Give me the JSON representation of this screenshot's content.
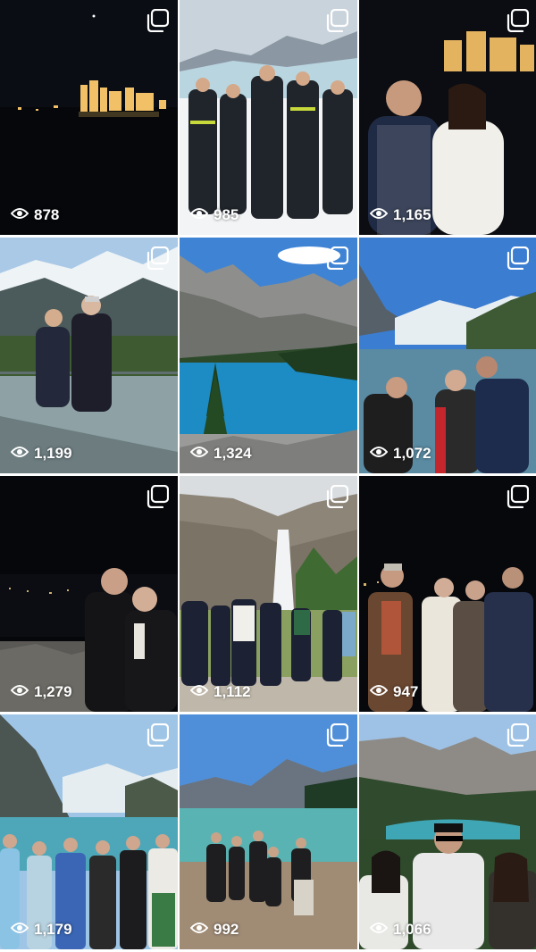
{
  "grid": {
    "posts": [
      {
        "views": "878",
        "scene": "night-castle-lights",
        "icon": "multi-photo-icon"
      },
      {
        "views": "985",
        "scene": "glacier-group-photo",
        "icon": "multi-photo-icon"
      },
      {
        "views": "1,165",
        "scene": "night-couple-castle",
        "icon": "multi-photo-icon"
      },
      {
        "views": "1,199",
        "scene": "glass-skywalk-mountains",
        "icon": "multi-photo-icon"
      },
      {
        "views": "1,324",
        "scene": "moraine-lake",
        "icon": "multi-photo-icon"
      },
      {
        "views": "1,072",
        "scene": "lake-group-selfie",
        "icon": "multi-photo-icon"
      },
      {
        "views": "1,279",
        "scene": "night-couple-overlook",
        "icon": "multi-photo-icon"
      },
      {
        "views": "1,112",
        "scene": "waterfall-group",
        "icon": "multi-photo-icon"
      },
      {
        "views": "947",
        "scene": "night-group-four",
        "icon": "multi-photo-icon"
      },
      {
        "views": "1,179",
        "scene": "lake-louise-group",
        "icon": "multi-photo-icon"
      },
      {
        "views": "992",
        "scene": "turquoise-lake-group",
        "icon": "multi-photo-icon"
      },
      {
        "views": "1,066",
        "scene": "peyto-lake-trio",
        "icon": "multi-photo-icon"
      }
    ]
  },
  "colors": {
    "overlay_text": "#ffffff",
    "gap": "#ffffff"
  }
}
